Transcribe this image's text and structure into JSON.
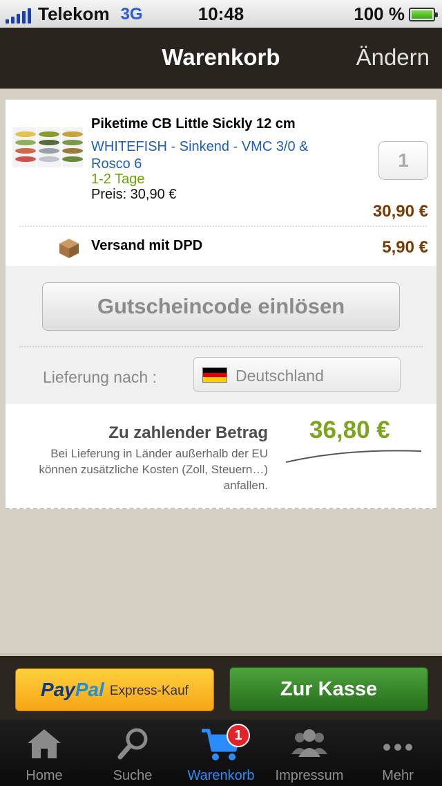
{
  "status_bar": {
    "carrier": "Telekom",
    "network": "3G",
    "time": "10:48",
    "battery": "100 %"
  },
  "nav": {
    "title": "Warenkorb",
    "edit_label": "Ändern"
  },
  "cart": {
    "item": {
      "title": "Piketime CB Little Sickly 12 cm",
      "variant": "WHITEFISH - Sinkend - VMC 3/0 & Rosco 6",
      "delivery_time": "1-2 Tage",
      "unit_price_label": "Preis: 30,90 €",
      "quantity": "1",
      "line_total": "30,90 €"
    },
    "shipping": {
      "label": "Versand mit DPD",
      "price": "5,90 €",
      "icon": "box-icon"
    },
    "coupon_label": "Gutscheincode einlösen",
    "delivery": {
      "label": "Lieferung nach :",
      "country": "Deutschland",
      "flag_colors": [
        "#000000",
        "#dd0000",
        "#ffce00"
      ]
    },
    "total": {
      "label": "Zu zahlender Betrag",
      "note": "Bei Lieferung in Länder außerhalb der EU können zusätzliche Kosten (Zoll, Steuern…) anfallen.",
      "amount": "36,80 €"
    }
  },
  "actions": {
    "paypal_pay": "Pay",
    "paypal_pal": "Pal",
    "paypal_sub": "Express-Kauf",
    "checkout_label": "Zur Kasse"
  },
  "tabs": [
    {
      "label": "Home",
      "icon": "home-icon"
    },
    {
      "label": "Suche",
      "icon": "search-icon"
    },
    {
      "label": "Warenkorb",
      "icon": "cart-icon",
      "badge": "1",
      "active": true
    },
    {
      "label": "Impressum",
      "icon": "people-icon"
    },
    {
      "label": "Mehr",
      "icon": "more-icon"
    }
  ],
  "colors": {
    "accent_price": "#7a3b00",
    "total_green": "#7aa51c",
    "link_blue": "#1f5fb3",
    "tab_active": "#2a8cff"
  }
}
